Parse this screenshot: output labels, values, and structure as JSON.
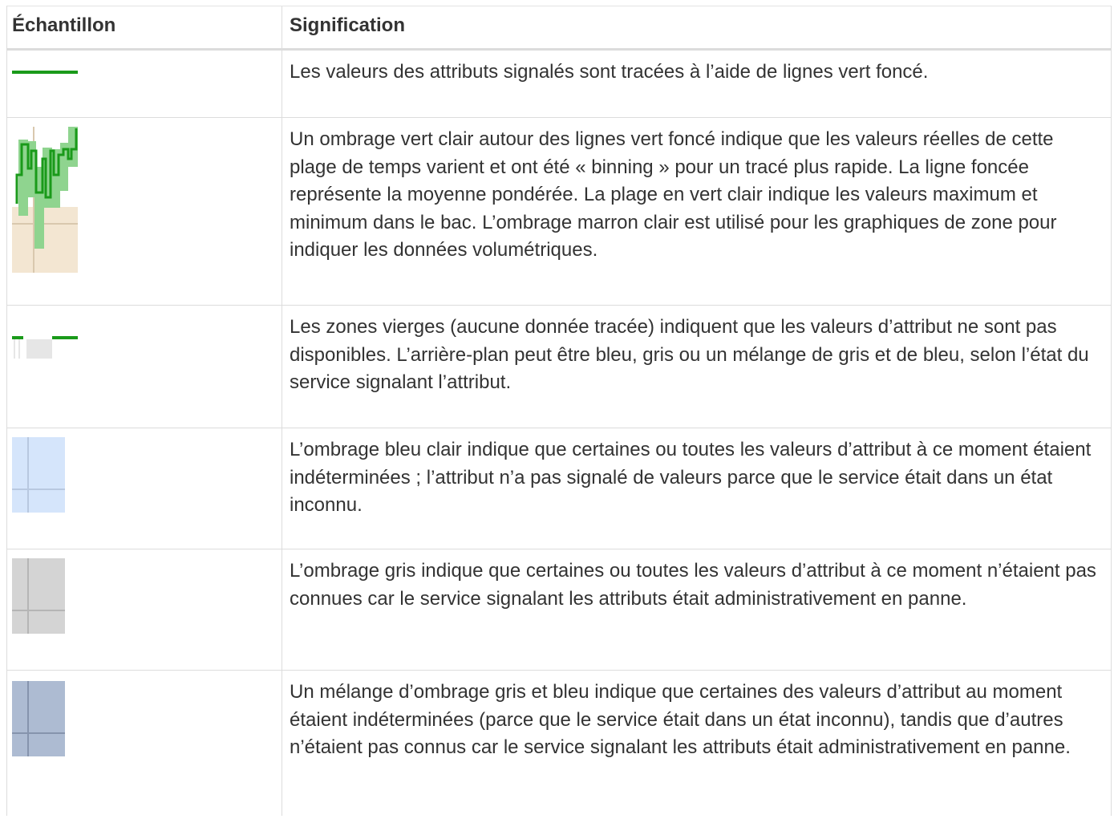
{
  "table": {
    "header": {
      "sample": "Échantillon",
      "meaning": "Signification"
    },
    "rows": [
      {
        "sample_icon": "dark-green-line-icon",
        "text": "Les valeurs des attributs signalés sont tracées à l’aide de lignes vert foncé."
      },
      {
        "sample_icon": "binned-graph-sample-icon",
        "text": "Un ombrage vert clair autour des lignes vert foncé indique que les valeurs réelles de cette plage de temps varient et ont été « binning » pour un tracé plus rapide. La ligne foncée représente la moyenne pondérée. La plage en vert clair indique les valeurs maximum et minimum dans le bac. L’ombrage marron clair est utilisé pour les graphiques de zone pour indiquer les données volumétriques."
      },
      {
        "sample_icon": "blank-gap-sample-icon",
        "text": "Les zones vierges (aucune donnée tracée) indiquent que les valeurs d’attribut ne sont pas disponibles. L’arrière-plan peut être bleu, gris ou un mélange de gris et de bleu, selon l’état du service signalant l’attribut."
      },
      {
        "sample_icon": "light-blue-shading-icon",
        "text": "L’ombrage bleu clair indique que certaines ou toutes les valeurs d’attribut à ce moment étaient indéterminées ; l’attribut n’a pas signalé de valeurs parce que le service était dans un état inconnu."
      },
      {
        "sample_icon": "gray-shading-icon",
        "text": "L’ombrage gris indique que certaines ou toutes les valeurs d’attribut à ce moment n’étaient pas connues car le service signalant les attributs était administrativement en panne."
      },
      {
        "sample_icon": "gray-blue-shading-icon",
        "text": "Un mélange d’ombrage gris et bleu indique que certaines des valeurs d’attribut au moment étaient indéterminées (parce que le service était dans un état inconnu), tandis que d’autres n’étaient pas connus car le service signalant les attributs était administrativement en panne."
      }
    ]
  },
  "colors": {
    "dark_green": "#1a9a1a",
    "light_green": "#8fd48f",
    "tan": "#f3e6d2",
    "light_blue": "#d5e5fb",
    "gray": "#d4d4d4",
    "gray_blue": "#adbbd2",
    "border": "#dcdcdc"
  }
}
